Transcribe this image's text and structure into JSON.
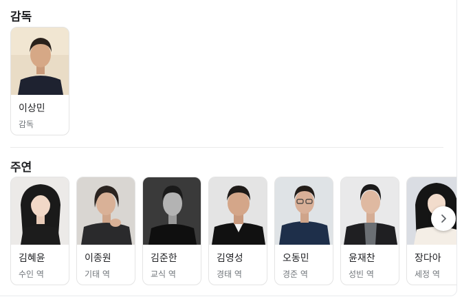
{
  "sections": {
    "director_title": "감독",
    "cast_title": "주연"
  },
  "director": {
    "name": "이상민",
    "role": "감독",
    "photo_bg": "#e9dcc6"
  },
  "cast": [
    {
      "name": "김혜윤",
      "role": "수인 역",
      "photo_bg": "#eceae8"
    },
    {
      "name": "이종원",
      "role": "기태 역",
      "photo_bg": "#d9d6d2"
    },
    {
      "name": "김준한",
      "role": "교식 역",
      "photo_bg": "#3a3a3a"
    },
    {
      "name": "김영성",
      "role": "경태 역",
      "photo_bg": "#e4e4e4"
    },
    {
      "name": "오동민",
      "role": "경준 역",
      "photo_bg": "#dfe3e6"
    },
    {
      "name": "윤재찬",
      "role": "성빈 역",
      "photo_bg": "#e9e9ea"
    },
    {
      "name": "장다아",
      "role": "세정 역",
      "photo_bg": "#dadde3"
    }
  ],
  "controls": {
    "next_icon": "chevron-right-icon"
  }
}
